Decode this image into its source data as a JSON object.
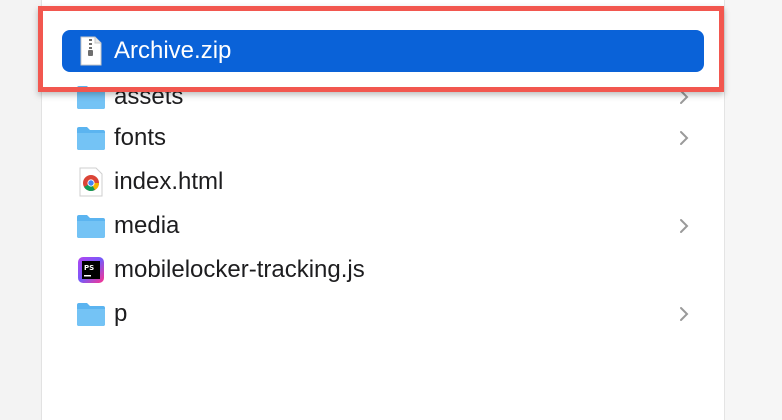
{
  "files": [
    {
      "name": "Archive.zip",
      "icon": "zip-file-icon",
      "folder": false,
      "selected": true
    },
    {
      "name": "assets",
      "icon": "folder-icon",
      "folder": true,
      "selected": false
    },
    {
      "name": "fonts",
      "icon": "folder-icon",
      "folder": true,
      "selected": false
    },
    {
      "name": "index.html",
      "icon": "chrome-document-icon",
      "folder": false,
      "selected": false
    },
    {
      "name": "media",
      "icon": "folder-icon",
      "folder": true,
      "selected": false
    },
    {
      "name": "mobilelocker-tracking.js",
      "icon": "phpstorm-file-icon",
      "folder": false,
      "selected": false
    },
    {
      "name": "p",
      "icon": "folder-icon",
      "folder": true,
      "selected": false
    }
  ],
  "colors": {
    "selection": "#0a62d8",
    "highlight_border": "#f2574f",
    "folder": "#5bb4f0"
  }
}
